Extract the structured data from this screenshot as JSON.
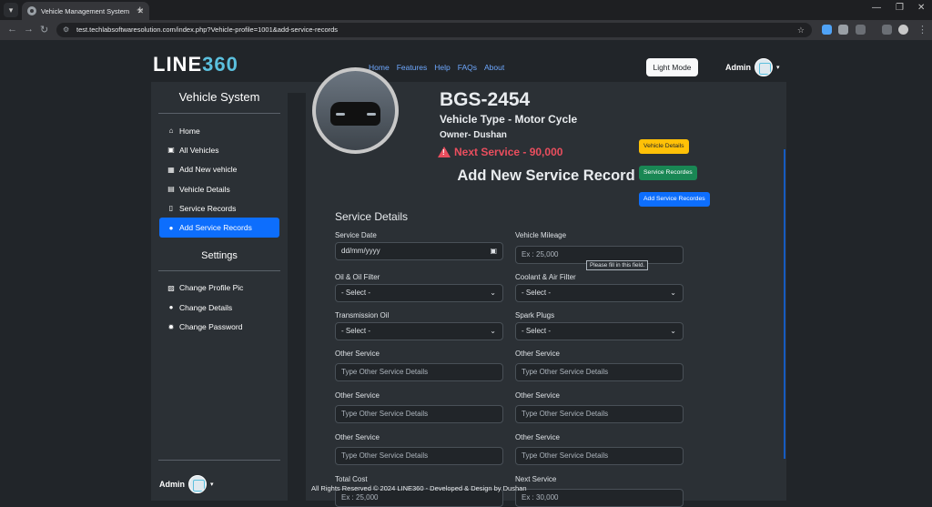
{
  "browser": {
    "tab_title": "Vehicle Management System",
    "url": "test.techlabsoftwaresolution.com/index.php?Vehicle-profile=1001&add-service-records"
  },
  "header": {
    "logo_text": "LINE",
    "logo_suffix": "360",
    "nav": [
      "Home",
      "Features",
      "Help",
      "FAQs",
      "About"
    ],
    "mode_button": "Light Mode",
    "user": "Admin"
  },
  "sidebar": {
    "title": "Vehicle System",
    "items": [
      {
        "icon": "home-icon",
        "glyph": "⌂",
        "label": "Home"
      },
      {
        "icon": "id-card-icon",
        "glyph": "▣",
        "label": "All Vehicles"
      },
      {
        "icon": "calendar-plus-icon",
        "glyph": "▦",
        "label": "Add New vehicle"
      },
      {
        "icon": "table-icon",
        "glyph": "▤",
        "label": "Vehicle Details"
      },
      {
        "icon": "file-icon",
        "glyph": "▯",
        "label": "Service Records"
      },
      {
        "icon": "user-plus-icon",
        "glyph": "●",
        "label": "Add Service Records"
      }
    ],
    "settings_title": "Settings",
    "settings_items": [
      {
        "icon": "image-icon",
        "glyph": "▨",
        "label": "Change Profile Pic"
      },
      {
        "icon": "user-gear-icon",
        "glyph": "●",
        "label": "Change Details"
      },
      {
        "icon": "gear-icon",
        "glyph": "✹",
        "label": "Change Password"
      }
    ],
    "user": "Admin"
  },
  "vehicle": {
    "plate": "BGS-2454",
    "type": "Vehicle Type - Motor Cycle",
    "owner": "Owner- Dushan",
    "next_service": "Next Service - 90,000"
  },
  "actions": {
    "details": "Vehicle Details",
    "records": "Service Recordes",
    "add": "Add Service Recordes"
  },
  "form": {
    "heading": "Add New Service Record",
    "section": "Service Details",
    "service_date_label": "Service Date",
    "service_date_value": "dd/mm/yyyy",
    "mileage_label": "Vehicle Mileage",
    "mileage_placeholder": "Ex : 25,000",
    "tooltip": "Please fill in this field.",
    "oil_label": "Oil & Oil Filter",
    "coolant_label": "Coolant & Air Filter",
    "transmission_label": "Transmission Oil",
    "spark_label": "Spark Plugs",
    "select_placeholder": "- Select -",
    "other_label": "Other Service",
    "other_placeholder": "Type Other Service Details",
    "total_cost_label": "Total Cost",
    "total_cost_placeholder": "Ex : 25,000",
    "next_service_label": "Next Service",
    "next_service_placeholder": "Ex : 30,000"
  },
  "footer": "All Rights Reserved © 2024 LINE360 - Developed & Design by Dushan"
}
